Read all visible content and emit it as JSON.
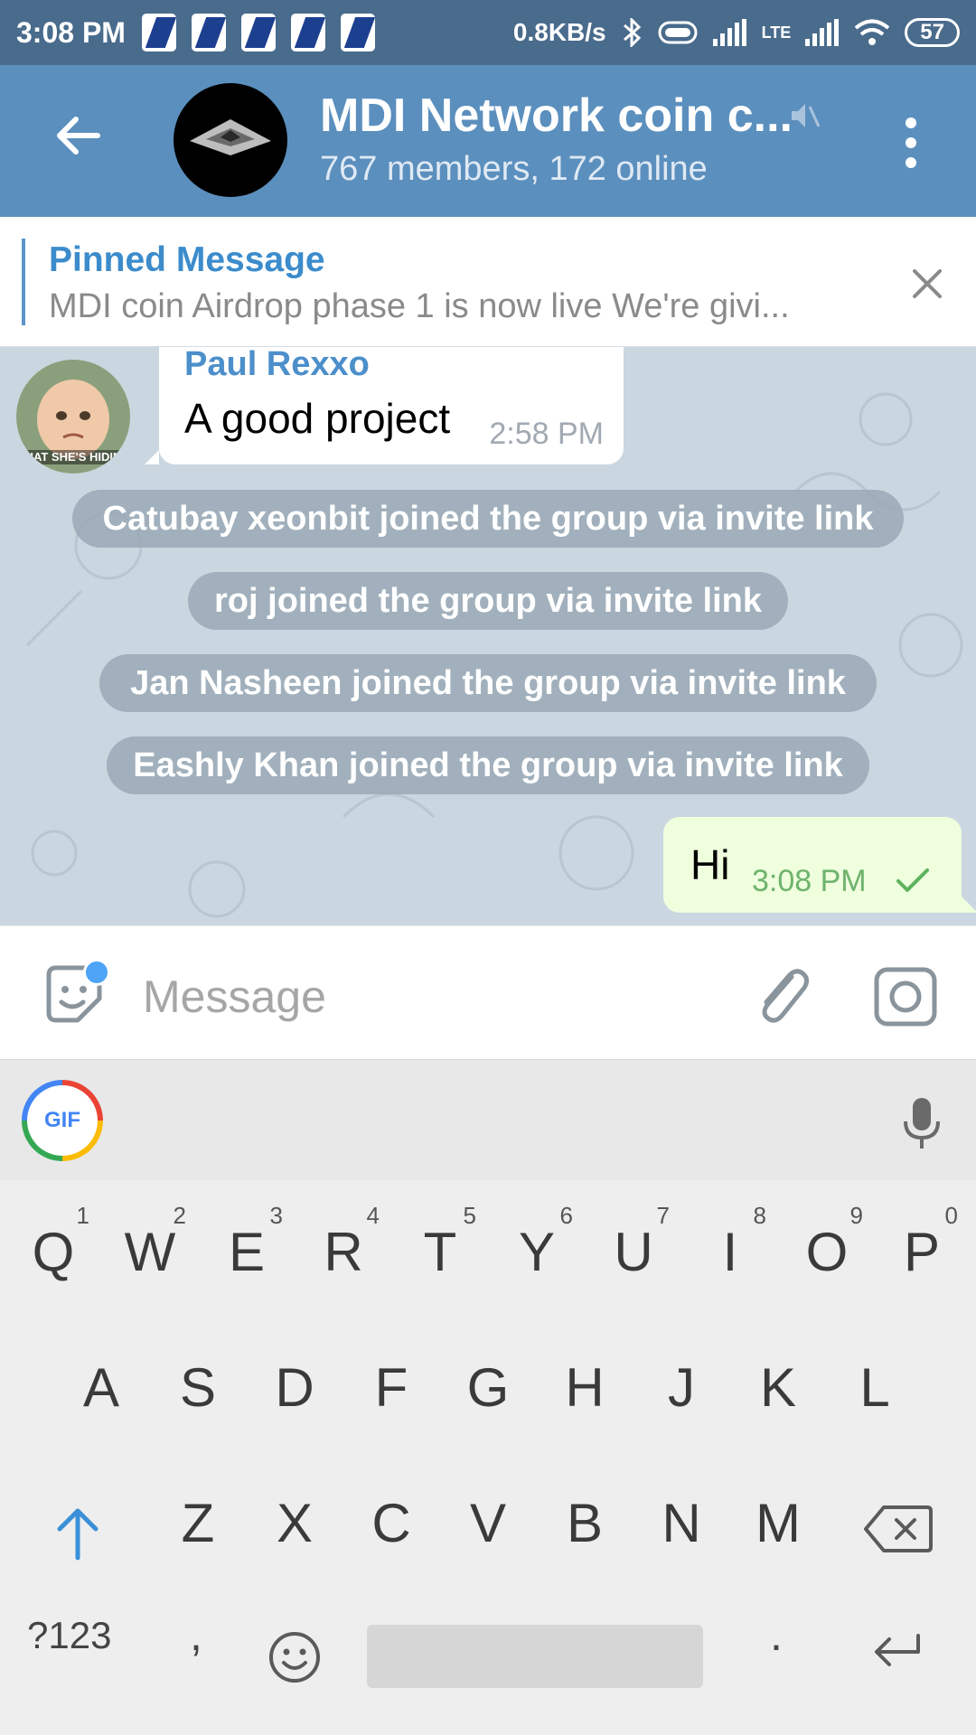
{
  "status_bar": {
    "time": "3:08 PM",
    "notif_label": "DGB",
    "speed": "0.8KB/s",
    "network": "LTE",
    "battery": "57"
  },
  "header": {
    "title": "MDI Network coin c...",
    "subtitle": "767 members, 172 online"
  },
  "pinned": {
    "label": "Pinned Message",
    "text": "MDI coin Airdrop phase 1 is now live We're givi..."
  },
  "messages": {
    "incoming": {
      "sender": "Paul Rexxo",
      "text": "A good project",
      "time": "2:58 PM",
      "avatar_caption": "HAT SHE'S HIDIN"
    },
    "service": [
      "Catubay xeonbit joined the group via invite link",
      "roj joined the group via invite link",
      "Jan Nasheen joined the group via invite link",
      "Eashly Khan joined the group via invite link"
    ],
    "outgoing": {
      "text": "Hi",
      "time": "3:08 PM"
    }
  },
  "composer": {
    "placeholder": "Message"
  },
  "keyboard": {
    "gif_label": "GIF",
    "row1": [
      {
        "k": "Q",
        "h": "1"
      },
      {
        "k": "W",
        "h": "2"
      },
      {
        "k": "E",
        "h": "3"
      },
      {
        "k": "R",
        "h": "4"
      },
      {
        "k": "T",
        "h": "5"
      },
      {
        "k": "Y",
        "h": "6"
      },
      {
        "k": "U",
        "h": "7"
      },
      {
        "k": "I",
        "h": "8"
      },
      {
        "k": "O",
        "h": "9"
      },
      {
        "k": "P",
        "h": "0"
      }
    ],
    "row2": [
      "A",
      "S",
      "D",
      "F",
      "G",
      "H",
      "J",
      "K",
      "L"
    ],
    "row3": [
      "Z",
      "X",
      "C",
      "V",
      "B",
      "N",
      "M"
    ],
    "symbols": "?123",
    "comma": ",",
    "period": "."
  },
  "colors": {
    "header": "#5b8fbe",
    "status_bar": "#496b8c",
    "accent": "#3c8ccc",
    "chat_bg": "#cad6e0",
    "outgoing_bubble": "#effedd"
  }
}
